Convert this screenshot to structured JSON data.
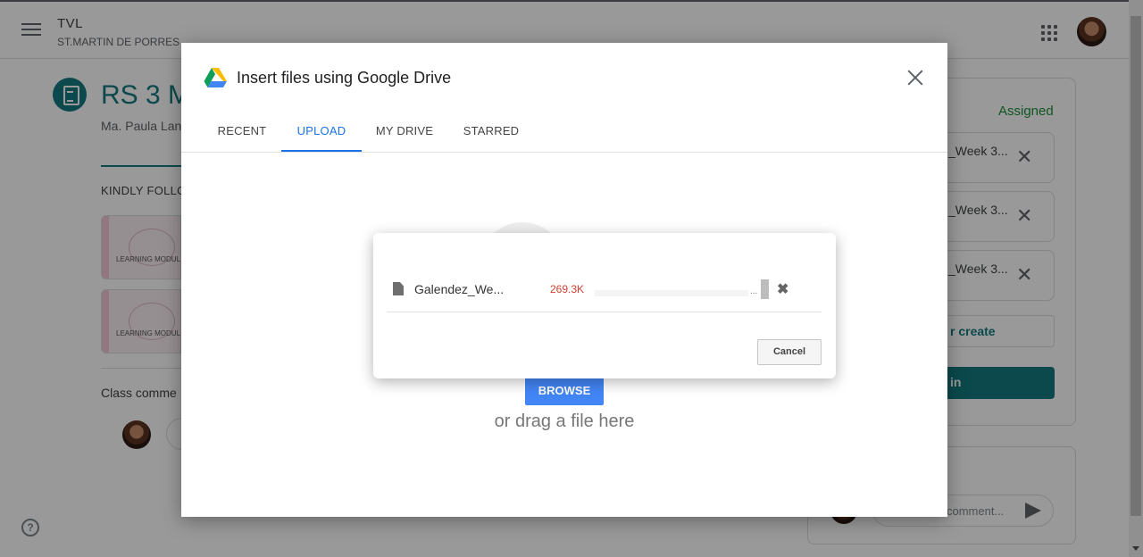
{
  "topbar": {
    "class_name": "TVL",
    "class_section": "ST.MARTIN DE PORRES"
  },
  "assignment": {
    "title": "RS 3 M",
    "author": "Ma. Paula Lan",
    "instructions": "KINDLY FOLLO",
    "thumbnails": [
      "LEARNING MODULE",
      "LEARNING MODULE"
    ],
    "class_comments": "Class comme"
  },
  "work": {
    "status": "Assigned",
    "files": [
      "_Week 3...",
      "_Week 3...",
      "_Week 3..."
    ],
    "add_create_label": "r create",
    "turn_in_label": "in",
    "private_comment_placeholder": "comment..."
  },
  "picker": {
    "title": "Insert files using Google Drive",
    "tabs": [
      {
        "label": "RECENT",
        "active": false
      },
      {
        "label": "UPLOAD",
        "active": true
      },
      {
        "label": "MY DRIVE",
        "active": false
      },
      {
        "label": "STARRED",
        "active": false
      }
    ],
    "browse_label": "BROWSE",
    "drag_text": "or drag a file here"
  },
  "upload": {
    "filename": "Galendez_We...",
    "filesize": "269.3K",
    "progress_percent": 100,
    "ellipsis": "...",
    "cancel_label": "Cancel"
  },
  "icons": {
    "menu": "hamburger-menu-icon",
    "apps": "google-apps-icon",
    "assignment": "assignment-icon",
    "close": "close-icon",
    "drive": "google-drive-icon",
    "document": "document-icon",
    "remove": "remove-x-icon",
    "help": "help-icon",
    "send": "send-icon"
  },
  "colors": {
    "accent_teal": "#137a7f",
    "google_blue": "#4285f4",
    "active_tab": "#1a73e8",
    "status_green": "#1e8e3e",
    "filesize_red": "#d23f31"
  }
}
